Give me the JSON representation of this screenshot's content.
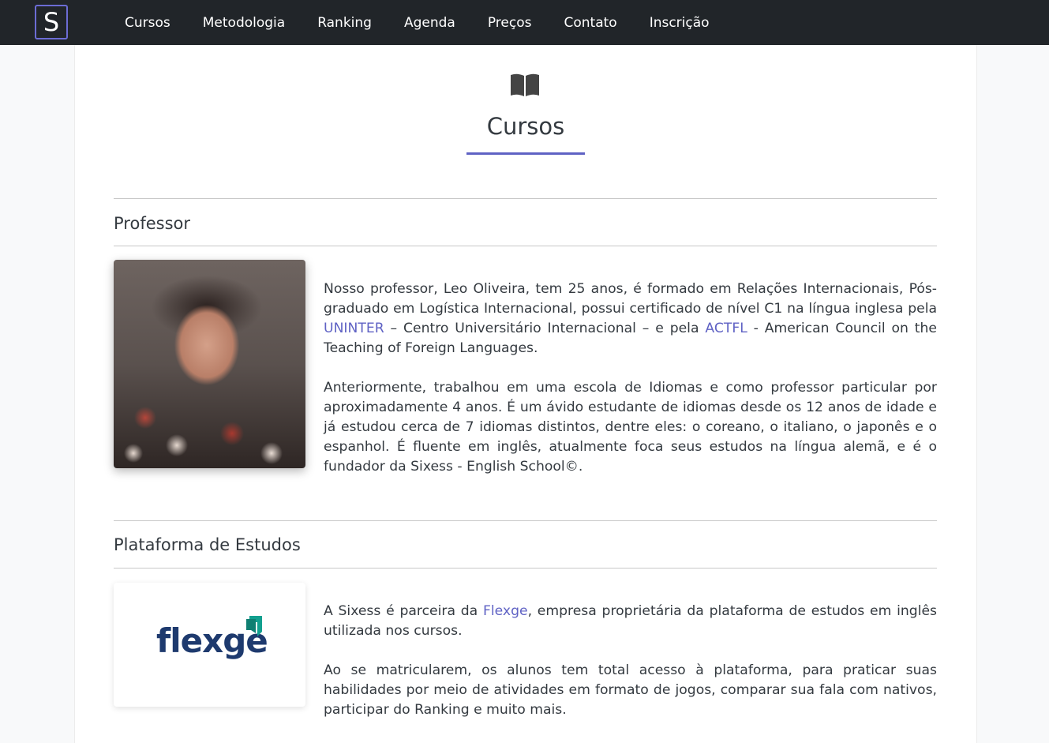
{
  "brand": {
    "logo_letter": "S"
  },
  "nav": {
    "items": [
      "Cursos",
      "Metodologia",
      "Ranking",
      "Agenda",
      "Preços",
      "Contato",
      "Inscrição"
    ]
  },
  "page": {
    "title": "Cursos",
    "accent_color": "#5f62c4"
  },
  "professor": {
    "heading": "Professor",
    "p1_pre": "Nosso professor, Leo Oliveira, tem 25 anos, é formado em Relações Internacionais, Pós-graduado em Logística Internacional, possui certificado de nível C1 na língua inglesa pela ",
    "p1_link1": "UNINTER",
    "p1_mid": " – Centro Universitário Internacional – e pela ",
    "p1_link2": "ACTFL",
    "p1_post": " - American Council on the Teaching of Foreign Languages.",
    "p2": "Anteriormente, trabalhou em uma escola de Idiomas e como professor particular por aproximadamente 4 anos. É um ávido estudante de idiomas desde os 12 anos de idade e já estudou cerca de 7 idiomas distintos, dentre eles: o coreano, o italiano, o japonês e o espanhol. É fluente em inglês, atualmente foca seus estudos na língua alemã, e é o fundador da Sixess - English School©."
  },
  "platform": {
    "heading": "Plataforma de Estudos",
    "logo_text": "flexge",
    "p1_pre": "A Sixess é parceira da ",
    "p1_link": "Flexge",
    "p1_post": ", empresa proprietária da plataforma de estudos em inglês utilizada nos cursos.",
    "p2": "Ao se matricularem, os alunos tem total acesso à plataforma, para praticar suas habilidades por meio de atividades em formato de jogos, comparar sua fala com nativos, participar do Ranking e muito mais."
  }
}
